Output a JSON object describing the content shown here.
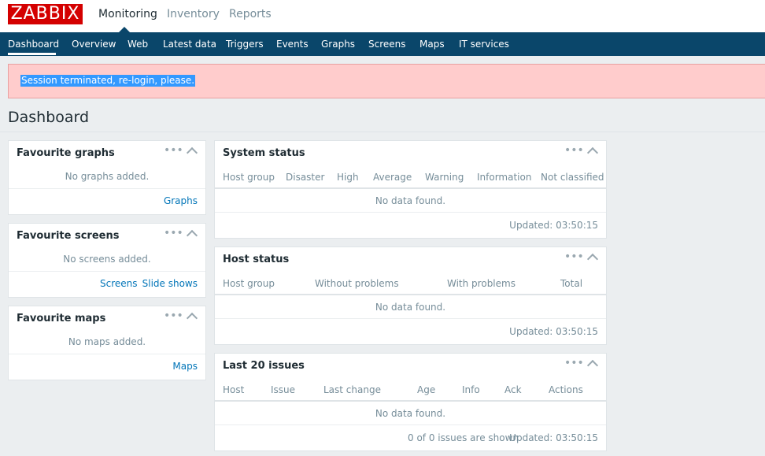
{
  "app": {
    "logo_text": "ZABBIX",
    "brand_color": "#d40000"
  },
  "top_nav": {
    "items": [
      {
        "label": "Monitoring",
        "active": true
      },
      {
        "label": "Inventory",
        "active": false
      },
      {
        "label": "Reports",
        "active": false
      }
    ]
  },
  "sub_nav": {
    "items": [
      {
        "label": "Dashboard",
        "active": true
      },
      {
        "label": "Overview"
      },
      {
        "label": "Web"
      },
      {
        "label": "Latest data"
      },
      {
        "label": "Triggers"
      },
      {
        "label": "Events"
      },
      {
        "label": "Graphs"
      },
      {
        "label": "Screens"
      },
      {
        "label": "Maps"
      },
      {
        "label": "IT services"
      }
    ],
    "background_color": "#0a466a"
  },
  "message": {
    "text": "Session terminated, re-login, please.",
    "background_color": "#ffcccc"
  },
  "page_title": "Dashboard",
  "widgets": {
    "fav_graphs": {
      "title": "Favourite graphs",
      "empty_text": "No graphs added.",
      "links": [
        "Graphs"
      ]
    },
    "fav_screens": {
      "title": "Favourite screens",
      "empty_text": "No screens added.",
      "links": [
        "Screens",
        "Slide shows"
      ]
    },
    "fav_maps": {
      "title": "Favourite maps",
      "empty_text": "No maps added.",
      "links": [
        "Maps"
      ]
    },
    "system_status": {
      "title": "System status",
      "columns": [
        "Host group",
        "Disaster",
        "High",
        "Average",
        "Warning",
        "Information",
        "Not classified"
      ],
      "empty_text": "No data found.",
      "updated": "Updated: 03:50:15"
    },
    "host_status": {
      "title": "Host status",
      "columns": [
        "Host group",
        "Without problems",
        "With problems",
        "Total"
      ],
      "empty_text": "No data found.",
      "updated": "Updated: 03:50:15"
    },
    "last_issues": {
      "title": "Last 20 issues",
      "columns": [
        "Host",
        "Issue",
        "Last change",
        "Age",
        "Info",
        "Ack",
        "Actions"
      ],
      "empty_text": "No data found.",
      "shown_text": "0 of 0 issues are shown",
      "updated": "Updated: 03:50:15"
    }
  },
  "icons": {
    "menu": "more-dots-icon",
    "collapse": "chevron-up-icon"
  }
}
